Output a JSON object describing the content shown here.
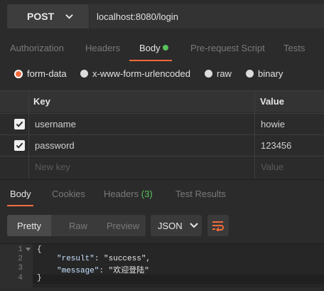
{
  "request": {
    "method": "POST",
    "url": "localhost:8080/login"
  },
  "request_tabs": [
    "Authorization",
    "Headers",
    "Body",
    "Pre-request Script",
    "Tests"
  ],
  "body_types": [
    {
      "label": "form-data",
      "selected": true
    },
    {
      "label": "x-www-form-urlencoded",
      "selected": false
    },
    {
      "label": "raw",
      "selected": false
    },
    {
      "label": "binary",
      "selected": false
    }
  ],
  "table": {
    "col_key": "Key",
    "col_value": "Value",
    "rows": [
      {
        "key": "username",
        "value": "howie",
        "checked": true
      },
      {
        "key": "password",
        "value": "123456",
        "checked": true
      }
    ],
    "new_key_placeholder": "New key",
    "new_value_placeholder": "Value"
  },
  "response_tabs": {
    "body": "Body",
    "cookies": "Cookies",
    "headers": "Headers",
    "headers_count": "(3)",
    "tests": "Test Results"
  },
  "view_modes": [
    "Pretty",
    "Raw",
    "Preview"
  ],
  "format": "JSON",
  "code_lines": [
    {
      "num": "1",
      "text": "{"
    },
    {
      "num": "2",
      "key": "\"result\"",
      "value": "\"success\","
    },
    {
      "num": "3",
      "key": "\"message\"",
      "value": "\"欢迎登陆\""
    },
    {
      "num": "4",
      "text": "}"
    }
  ],
  "colors": {
    "accent": "#f26b3a",
    "green": "#57c35a",
    "background": "#2b2b2b"
  }
}
